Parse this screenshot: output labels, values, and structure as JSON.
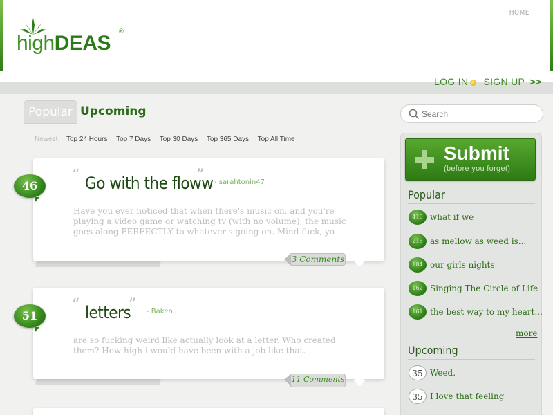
{
  "header": {
    "logo_high": "high",
    "logo_deas": "DEAS",
    "logo_reg": "®",
    "nav_home": "HOME",
    "login": "LOG IN",
    "signup": "SIGN UP",
    "signup_arrows": ">>"
  },
  "tabs": {
    "popular": "Popular",
    "upcoming": "Upcoming"
  },
  "filters": [
    "Newest",
    "Top 24 Hours",
    "Top 7 Days",
    "Top 30 Days",
    "Top 365 Days",
    "Top All Time"
  ],
  "ideas": [
    {
      "score": "46",
      "quote_open": "“",
      "title": "Go with the floww",
      "quote_close": "”",
      "author": "- sarahtonin47",
      "body": "Have you ever noticed that when there's music on, and you're playing a video game or watching tv (with no volume), the music goes along PERFECTLY to whatever's going on. Mind fuck, yo",
      "comments": "3 Comments"
    },
    {
      "score": "51",
      "quote_open": "“",
      "title": "letters",
      "quote_close": "”",
      "author": "- Baken",
      "body": "are so fucking weird like actually look at a letter. Who created them? How high i would have been with a job like that.",
      "comments": "11 Comments"
    }
  ],
  "search": {
    "placeholder": "Search"
  },
  "sidebar": {
    "submit_title": "Submit",
    "submit_sub": "(before you forget)",
    "popular_heading": "Popular",
    "popular_items": [
      {
        "score": "416",
        "label": "what if we"
      },
      {
        "score": "216",
        "label": "as mellow as weed is..."
      },
      {
        "score": "184",
        "label": "our girls nights"
      },
      {
        "score": "162",
        "label": "Singing The Circle of Life"
      },
      {
        "score": "161",
        "label": "the best way to my heart..."
      }
    ],
    "more": "more",
    "upcoming_heading": "Upcoming",
    "upcoming_items": [
      {
        "score": "35",
        "label": "Weed."
      },
      {
        "score": "35",
        "label": "I love that feeling"
      }
    ]
  },
  "colors": {
    "brand_green": "#2b7a18",
    "accent_green": "#3d8f22",
    "background": "#e9ebe9"
  }
}
